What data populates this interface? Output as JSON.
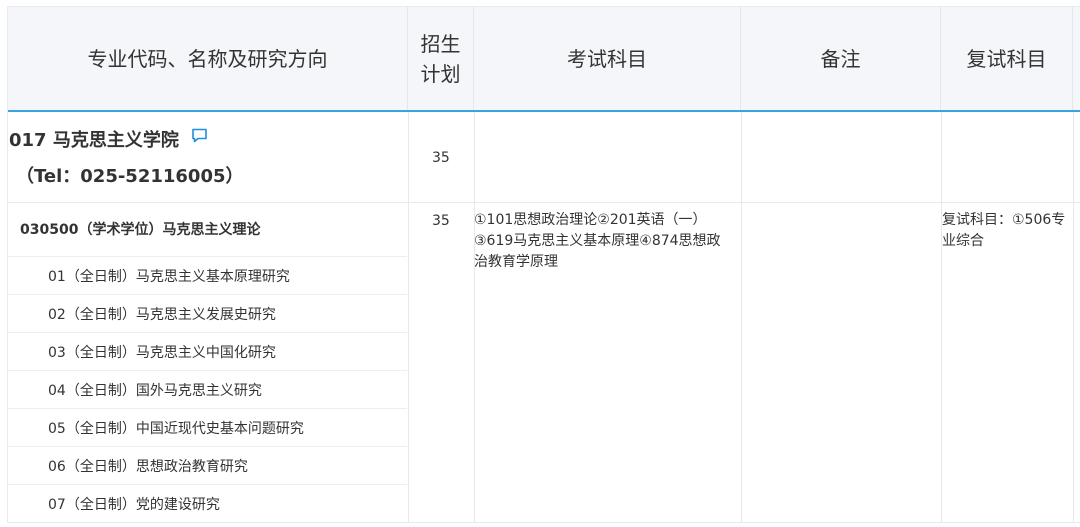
{
  "header": {
    "col_major": "专业代码、名称及研究方向",
    "col_plan_line1": "招生",
    "col_plan_line2": "计划",
    "col_exam": "考试科目",
    "col_note": "备注",
    "col_retest": "复试科目"
  },
  "school": {
    "name": "017 马克思主义学院",
    "tel": "（Tel：025-52116005）",
    "plan": "35",
    "comment_icon": "comment-icon",
    "accent_color": "#1d8fe1"
  },
  "major": {
    "title": "030500（学术学位）马克思主义理论",
    "plan": "35",
    "exam": "①101思想政治理论②201英语（一）③619马克思主义基本原理④874思想政治教育学原理",
    "retest": "复试科目：①506专业综合",
    "directions": [
      "01（全日制）马克思主义基本原理研究",
      "02（全日制）马克思主义发展史研究",
      "03（全日制）马克思主义中国化研究",
      "04（全日制）国外马克思主义研究",
      "05（全日制）中国近现代史基本问题研究",
      "06（全日制）思想政治教育研究",
      "07（全日制）党的建设研究"
    ]
  }
}
